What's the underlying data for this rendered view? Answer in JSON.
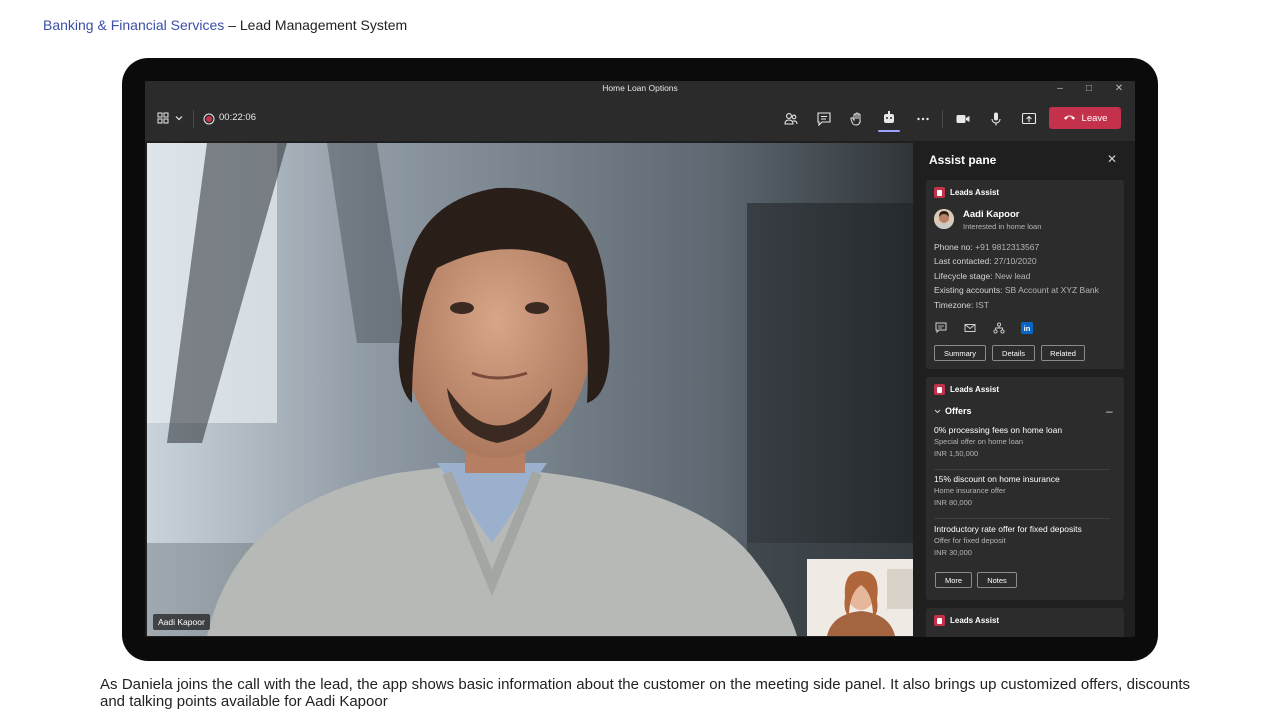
{
  "slide": {
    "title_accent": "Banking & Financial Services",
    "title_rest": " – Lead Management System",
    "caption": "As Daniela joins the call with the lead, the app shows basic information about the customer on the meeting side panel. It also brings up customized offers, discounts and talking points available for Aadi Kapoor"
  },
  "window": {
    "title": "Home Loan Options",
    "controls": {
      "minimize": "–",
      "maximize": "□",
      "close": "✕"
    }
  },
  "toolbar": {
    "recording_time": "00:22:06",
    "leave_label": "Leave",
    "icons": [
      "layout-grid-icon",
      "chevron-down-icon",
      "record-icon",
      "people-icon",
      "chat-icon",
      "raise-hand-icon",
      "apps-icon",
      "more-icon",
      "camera-icon",
      "mic-icon",
      "share-screen-icon",
      "hangup-icon"
    ],
    "accent_color": "#c4314b",
    "active_indicator_color": "#9ea2ff"
  },
  "video": {
    "participant_name": "Aadi Kapoor"
  },
  "assist_pane": {
    "title": "Assist pane",
    "contact_card": {
      "app_name": "Leads Assist",
      "name": "Aadi Kapoor",
      "subtitle": "Interested in home loan",
      "fields": [
        {
          "label": "Phone no:",
          "value": " +91 9812313567"
        },
        {
          "label": "Last contacted:",
          "value": " 27/10/2020"
        },
        {
          "label": "Lifecycle stage:",
          "value": " New lead"
        },
        {
          "label": "Existing accounts:",
          "value": " SB Account at XYZ Bank"
        },
        {
          "label": "Timezone:",
          "value": " IST"
        }
      ],
      "action_icons": [
        "chat-icon",
        "mail-icon",
        "org-chart-icon",
        "linkedin-icon"
      ],
      "linkedin_text": "in",
      "buttons": [
        "Summary",
        "Details",
        "Related"
      ]
    },
    "offers_card": {
      "app_name": "Leads Assist",
      "section_title": "Offers",
      "offers": [
        {
          "title": "0% processing fees on home loan",
          "subtitle": "Special offer on home loan",
          "amount": "INR 1,50,000"
        },
        {
          "title": "15% discount on home insurance",
          "subtitle": "Home insurance offer",
          "amount": "INR 80,000"
        },
        {
          "title": "Introductory rate offer for fixed deposits",
          "subtitle": "Offer for fixed deposit",
          "amount": "INR 30,000"
        }
      ],
      "buttons": [
        "More",
        "Notes"
      ]
    },
    "third_card": {
      "app_name": "Leads Assist"
    }
  }
}
